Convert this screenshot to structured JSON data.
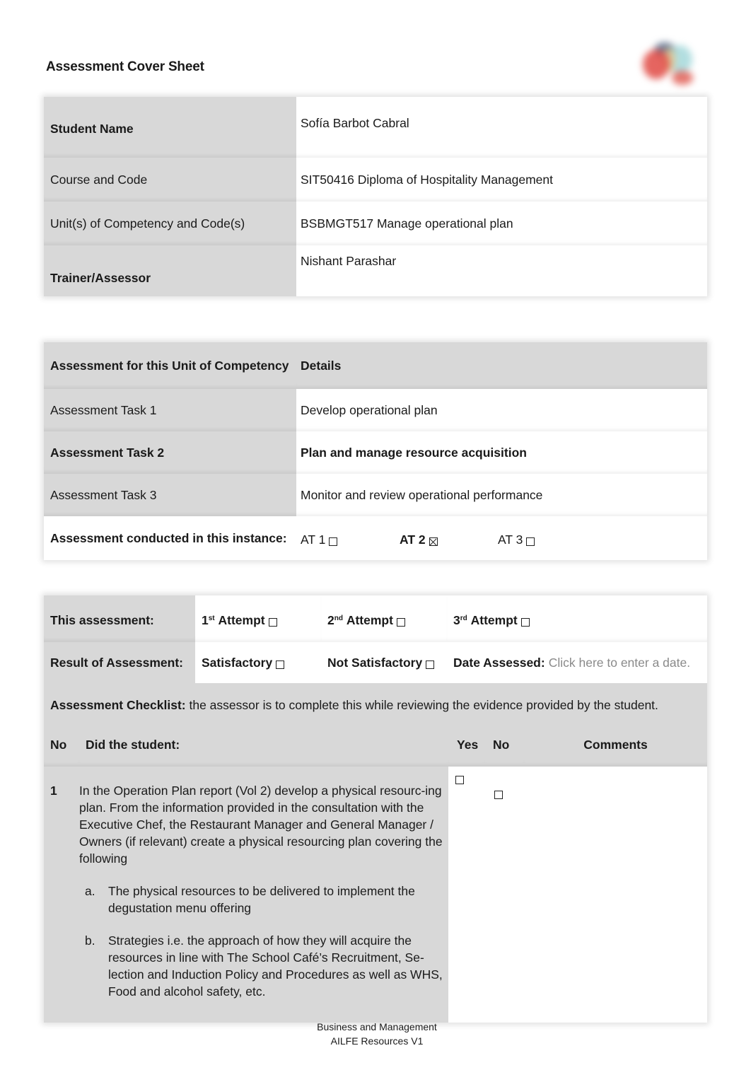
{
  "header": {
    "title": "Assessment Cover Sheet",
    "logo": "organization-logo"
  },
  "student_info": {
    "rows": [
      {
        "label": "Student Name",
        "value": "Sofía Barbot Cabral"
      },
      {
        "label": "Course and Code",
        "value": "SIT50416 Diploma of Hospitality Management"
      },
      {
        "label": "Unit(s) of Competency and Code(s)",
        "value": "BSBMGT517 Manage operational plan"
      },
      {
        "label": "Trainer/Assessor",
        "value": "Nishant Parashar"
      }
    ]
  },
  "assessment_tasks": {
    "header_col1": "Assessment for this Unit of Competency",
    "header_col2": "Details",
    "rows": [
      {
        "label": "Assessment Task 1",
        "value": "Develop operational plan"
      },
      {
        "label": "Assessment Task 2",
        "value": "Plan and manage resource acquisition"
      },
      {
        "label": "Assessment Task 3",
        "value": "Monitor and review operational performance"
      }
    ],
    "conducted_label": "Assessment conducted in this instance:",
    "conducted_options": [
      {
        "label": "AT 1",
        "checked": false
      },
      {
        "label": "AT 2",
        "checked": true
      },
      {
        "label": "AT 3",
        "checked": false
      }
    ]
  },
  "attempt": {
    "label": "This assessment:",
    "options": [
      {
        "num": "1",
        "sup": "st",
        "text": "Attempt",
        "checked": false
      },
      {
        "num": "2",
        "sup": "nd",
        "text": "Attempt",
        "checked": false
      },
      {
        "num": "3",
        "sup": "rd",
        "text": "Attempt",
        "checked": false
      }
    ]
  },
  "result": {
    "label": "Result of Assessment:",
    "satisfactory": "Satisfactory",
    "not_satisfactory": "Not Satisfactory",
    "date_label": "Date Assessed:",
    "date_placeholder": "Click here to enter a date."
  },
  "checklist": {
    "intro_bold": "Assessment Checklist:",
    "intro_text": " the assessor is to complete this while reviewing the evidence provided by the student.",
    "columns": [
      "No",
      "Did the student:",
      "Yes",
      "No",
      "Comments"
    ],
    "items": [
      {
        "no": "1",
        "text": "In the Operation Plan report (Vol 2) develop a physical resourc-ing plan. From the information provided in the consultation with the Executive Chef, the Restaurant Manager and General Manager / Owners (if relevant) create a physical resourcing plan covering the following",
        "subitems": [
          {
            "label": "a.",
            "text": "The physical resources to be delivered to implement the degustation menu offering"
          },
          {
            "label": "b.",
            "text": "Strategies i.e. the approach of how they will acquire the resources in line with The School Café’s Recruitment, Se-lection and Induction Policy and Procedures as well as WHS, Food and alcohol safety, etc."
          }
        ],
        "yes": false,
        "no_checked": false,
        "comments": ""
      }
    ]
  },
  "footer": {
    "line1": "Business and Management",
    "line2": "AILFE Resources V1"
  }
}
